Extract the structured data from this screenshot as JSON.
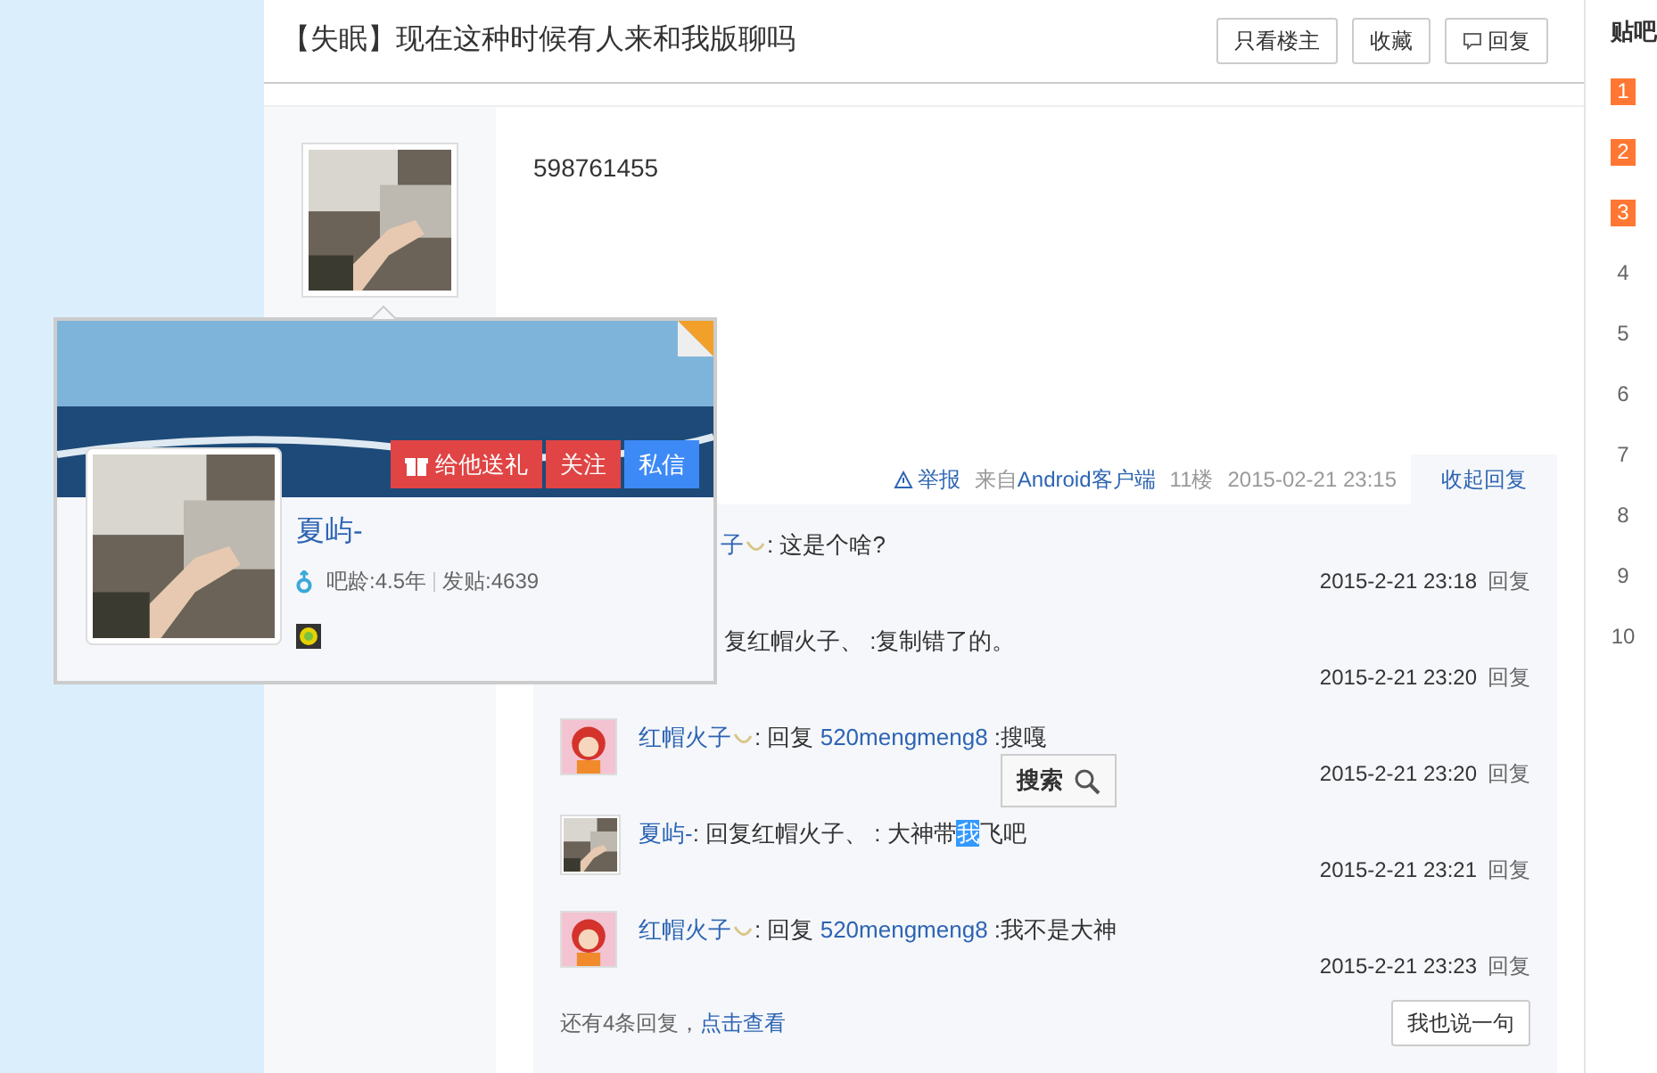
{
  "thread": {
    "title": "【失眠】现在这种时候有人来和我版聊吗",
    "actions": [
      {
        "label": "只看楼主"
      },
      {
        "label": "收藏"
      },
      {
        "label": "回复"
      }
    ]
  },
  "post": {
    "content": "598761455",
    "meta": {
      "report": "举报",
      "source": "来自Android客户端",
      "floor": "11楼",
      "time": "2015-02-21 23:15",
      "toggle": "收起回复"
    },
    "replies": [
      {
        "kind": "covered",
        "author": "子",
        "badge": true,
        "segments": [
          {
            "text": ": 这是个啥?",
            "highlighted": false
          }
        ],
        "time": "2015-2-21 23:18",
        "reply": "回复"
      },
      {
        "kind": "covered",
        "badge": false,
        "segments": [
          {
            "text": "复红帽火子、 :复制错了的。",
            "highlighted": false
          }
        ],
        "time": "2015-2-21 23:20",
        "reply": "回复"
      },
      {
        "kind": "cartoon",
        "author": "红帽火子",
        "badge": true,
        "segments": [
          {
            "text": ": 回复 ",
            "highlighted": false
          },
          {
            "text": "520mengmeng8",
            "link": true,
            "highlighted": false
          },
          {
            "text": " :搜嘎",
            "highlighted": false
          }
        ],
        "time": "2015-2-21 23:20",
        "reply": "回复"
      },
      {
        "kind": "photo",
        "author": "夏屿-",
        "badge": false,
        "segments": [
          {
            "text": ": 回复红帽火子、 : 大神带",
            "highlighted": false
          },
          {
            "text": "我",
            "highlighted": true
          },
          {
            "text": "飞吧",
            "highlighted": false
          }
        ],
        "time": "2015-2-21 23:21",
        "reply": "回复"
      },
      {
        "kind": "cartoon",
        "author": "红帽火子",
        "badge": true,
        "segments": [
          {
            "text": ": 回复 ",
            "highlighted": false
          },
          {
            "text": "520mengmeng8",
            "link": true,
            "highlighted": false
          },
          {
            "text": " :我不是大神",
            "highlighted": false
          }
        ],
        "time": "2015-2-21 23:23",
        "reply": "回复"
      }
    ],
    "more": {
      "text": "还有4条回复，",
      "link": "点击查看"
    },
    "say_button": "我也说一句"
  },
  "search_tooltip": {
    "label": "搜索"
  },
  "profile_card": {
    "name": "夏屿-",
    "age": "吧龄:4.5年",
    "posts": "发贴:4639",
    "buttons": [
      {
        "label": "给他送礼",
        "kind": "gift"
      },
      {
        "label": "关注",
        "kind": "follow"
      },
      {
        "label": "私信",
        "kind": "message"
      }
    ]
  },
  "sidebar": {
    "title": "贴吧",
    "ranks": [
      {
        "num": "1",
        "hot": true
      },
      {
        "num": "2",
        "hot": true
      },
      {
        "num": "3",
        "hot": true
      },
      {
        "num": "4",
        "hot": false
      },
      {
        "num": "5",
        "hot": false
      },
      {
        "num": "6",
        "hot": false
      },
      {
        "num": "7",
        "hot": false
      },
      {
        "num": "8",
        "hot": false
      },
      {
        "num": "9",
        "hot": false
      },
      {
        "num": "10",
        "hot": false
      }
    ]
  }
}
